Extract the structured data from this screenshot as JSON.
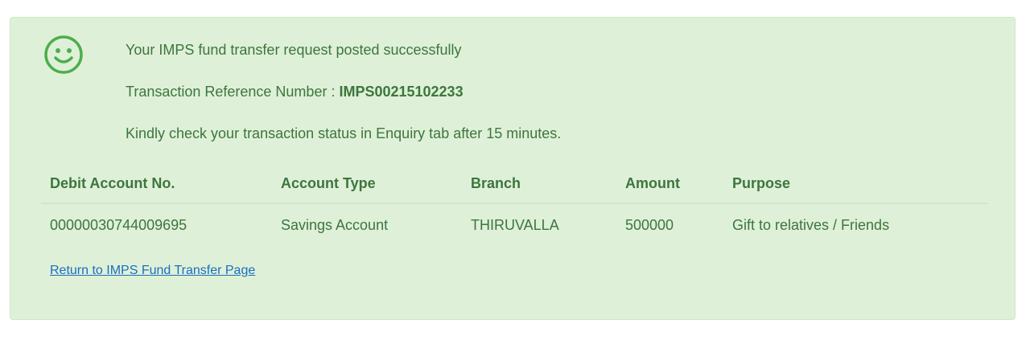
{
  "message": {
    "success_text": "Your IMPS fund transfer request posted successfully",
    "reference_label": "Transaction Reference Number : ",
    "reference_number": "IMPS00215102233",
    "enquiry_note": "Kindly check your transaction status in Enquiry tab after 15 minutes."
  },
  "icon": "smiley-icon",
  "table": {
    "headers": [
      "Debit Account No.",
      "Account Type",
      "Branch",
      "Amount",
      "Purpose"
    ],
    "rows": [
      [
        "00000030744009695",
        "Savings Account",
        "THIRUVALLA",
        "500000",
        "Gift to relatives / Friends"
      ]
    ]
  },
  "return_link": "Return to IMPS Fund Transfer Page",
  "colors": {
    "panel_bg": "#dff0d8",
    "text_green": "#3c763d",
    "icon_green": "#4cae4c",
    "link_blue": "#1a6fbf"
  }
}
